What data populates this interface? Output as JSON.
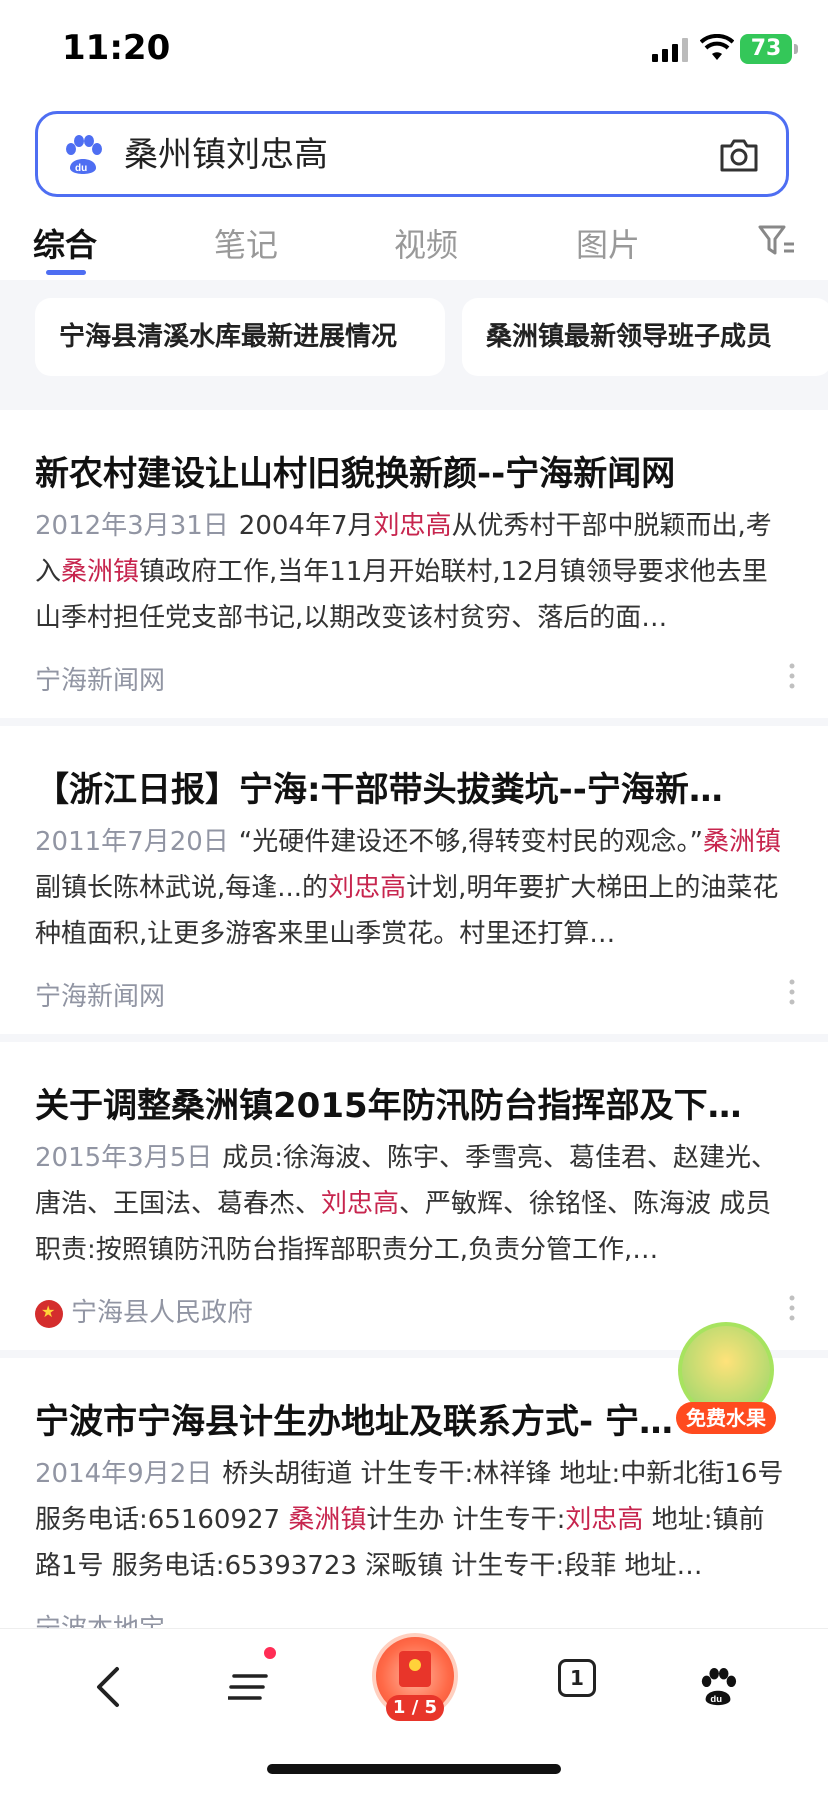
{
  "status_bar": {
    "time": "11:20",
    "battery_level": "73"
  },
  "search": {
    "query": "桑州镇刘忠高"
  },
  "tabs": [
    {
      "label": "综合",
      "active": true
    },
    {
      "label": "笔记",
      "active": false
    },
    {
      "label": "视频",
      "active": false
    },
    {
      "label": "图片",
      "active": false
    }
  ],
  "suggestions": [
    "宁海县清溪水库最新进展情况",
    "桑洲镇最新领导班子成员"
  ],
  "results": [
    {
      "title": "新农村建设让山村旧貌换新颜--宁海新闻网",
      "date": "2012年3月31日",
      "snippet": [
        {
          "t": "2004年7月",
          "hl": false
        },
        {
          "t": "刘忠高",
          "hl": true
        },
        {
          "t": "从优秀村干部中脱颖而出,考入",
          "hl": false
        },
        {
          "t": "桑洲镇",
          "hl": true
        },
        {
          "t": "镇政府工作,当年11月开始联村,12月镇领导要求他去里山季村担任党支部书记,以期改变该村贫穷、落后的面…",
          "hl": false
        }
      ],
      "source": "宁海新闻网"
    },
    {
      "title": "【浙江日报】宁海:干部带头拔粪坑--宁海新…",
      "date": "2011年7月20日",
      "snippet": [
        {
          "t": "“光硬件建设还不够,得转变村民的观念。”",
          "hl": false
        },
        {
          "t": "桑洲镇",
          "hl": true
        },
        {
          "t": "副镇长陈林武说,每逢...的",
          "hl": false
        },
        {
          "t": "刘忠高",
          "hl": true
        },
        {
          "t": "计划,明年要扩大梯田上的油菜花种植面积,让更多游客来里山季赏花。村里还打算…",
          "hl": false
        }
      ],
      "source": "宁海新闻网"
    },
    {
      "title": "关于调整桑洲镇2015年防汛防台指挥部及下…",
      "date": "2015年3月5日",
      "snippet": [
        {
          "t": "成员:徐海波、陈宇、季雪亮、葛佳君、赵建光、唐浩、王国法、葛春杰、",
          "hl": false
        },
        {
          "t": "刘忠高",
          "hl": true
        },
        {
          "t": "、严敏辉、徐铭怪、陈海波 成员职责:按照镇防汛防台指挥部职责分工,负责分管工作,…",
          "hl": false
        }
      ],
      "source": "宁海县人民政府"
    },
    {
      "title": "宁波市宁海县计生办地址及联系方式- 宁…",
      "date": "2014年9月2日",
      "snippet": [
        {
          "t": "桥头胡街道 计生专干:林祥锋 地址:中新北街16号 服务电话:65160927 ",
          "hl": false
        },
        {
          "t": "桑洲镇",
          "hl": true
        },
        {
          "t": "计生办 计生专干:",
          "hl": false
        },
        {
          "t": "刘忠高",
          "hl": true
        },
        {
          "t": " 地址:镇前路1号 服务电话:65393723 深畈镇 计生专干:段菲 地址…",
          "hl": false
        }
      ],
      "source": "宁波本地宝"
    }
  ],
  "promo": {
    "label": "免费水果"
  },
  "bottom_bar": {
    "redpacket_progress": "1 / 5",
    "tab_count": "1"
  },
  "colors": {
    "accent": "#4e6ef2",
    "highlight": "#c7254e",
    "meta": "#9195a3"
  }
}
